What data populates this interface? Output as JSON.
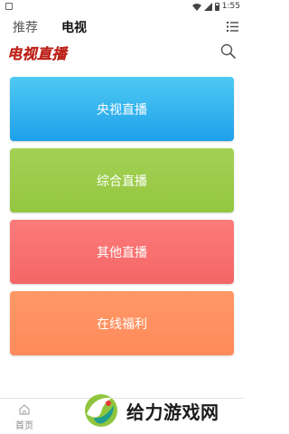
{
  "status_bar": {
    "time": "1:55"
  },
  "tabs": [
    {
      "label": "推荐"
    },
    {
      "label": "电视"
    }
  ],
  "header": {
    "app_title": "电视直播"
  },
  "categories": [
    {
      "label": "央视直播",
      "color": "#2aaaf0"
    },
    {
      "label": "综合直播",
      "color": "#9bcb48"
    },
    {
      "label": "其他直播",
      "color": "#f86f6f"
    },
    {
      "label": "在线福利",
      "color": "#ff8f5f"
    }
  ],
  "bottom_nav": {
    "home_label": "首页"
  },
  "watermark": {
    "text": "给力游戏网"
  },
  "icons": {
    "status_left": "square-icon",
    "wifi": "wifi-icon",
    "signal": "signal-icon",
    "battery": "battery-icon",
    "menu": "list-menu-icon",
    "search": "search-icon",
    "home": "home-icon"
  }
}
